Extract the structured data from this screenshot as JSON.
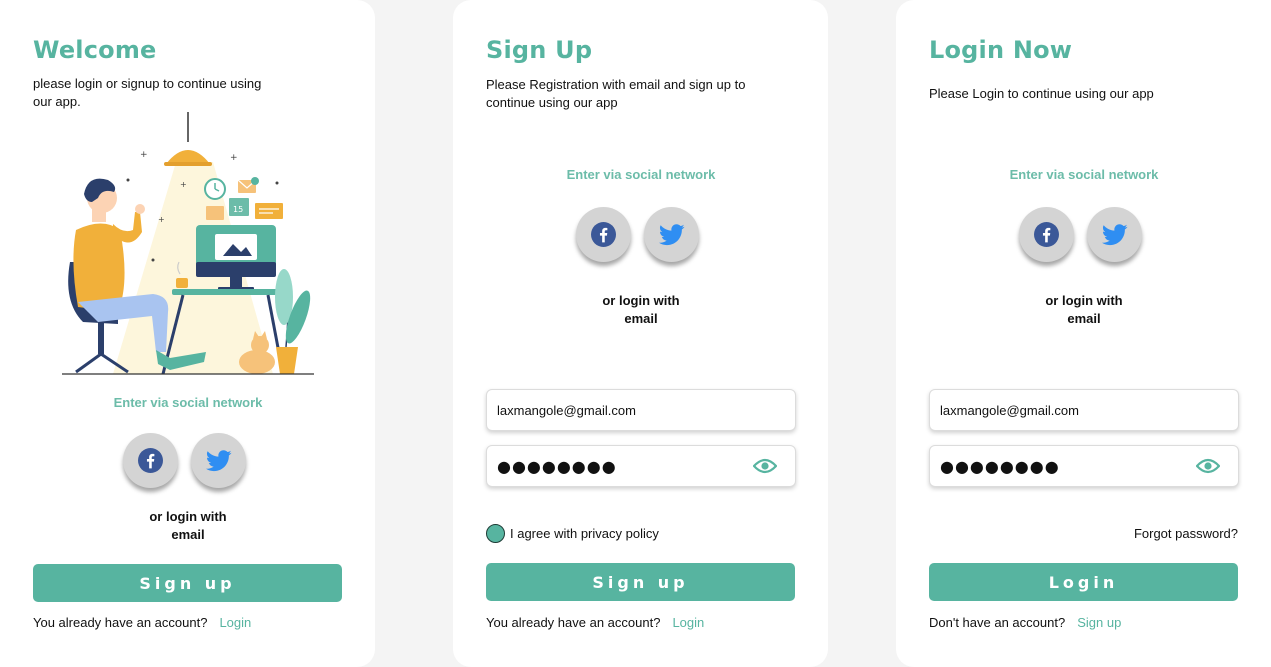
{
  "welcome": {
    "title": "Welcome",
    "subtitle": "please login or signup to continue using our app.",
    "social_label": "Enter via social  network",
    "or_login": "or login with\nemail",
    "primary_button": "Sign up",
    "footer_text": "You already have an account?",
    "footer_link": "Login"
  },
  "signup": {
    "title": "Sign Up",
    "subtitle": "Please Registration with email and sign up to continue using our app",
    "social_label": "Enter via social  network",
    "or_login": "or login with\nemail",
    "email_value": "laxmangole@gmail.com",
    "password_mask": "●●●●●●●●",
    "agree_label": "I agree with privacy policy",
    "primary_button": "Sign up",
    "footer_text": "You already have an account?",
    "footer_link": "Login"
  },
  "login": {
    "title": "Login Now",
    "subtitle": "Please Login to continue using our app",
    "social_label": "Enter via social  network",
    "or_login": "or login with\nemail",
    "email_value": "laxmangole@gmail.com",
    "password_mask": "●●●●●●●●",
    "forgot_label": "Forgot password?",
    "primary_button": "Login",
    "footer_text": "Don't have an account?",
    "footer_link": "Sign up"
  },
  "icons": {
    "facebook": "facebook-icon",
    "twitter": "twitter-icon",
    "eye": "eye-icon"
  },
  "colors": {
    "accent": "#57b4a0",
    "facebook": "#3b5898",
    "twitter": "#2f8ef2",
    "background": "#f4f4f4"
  }
}
